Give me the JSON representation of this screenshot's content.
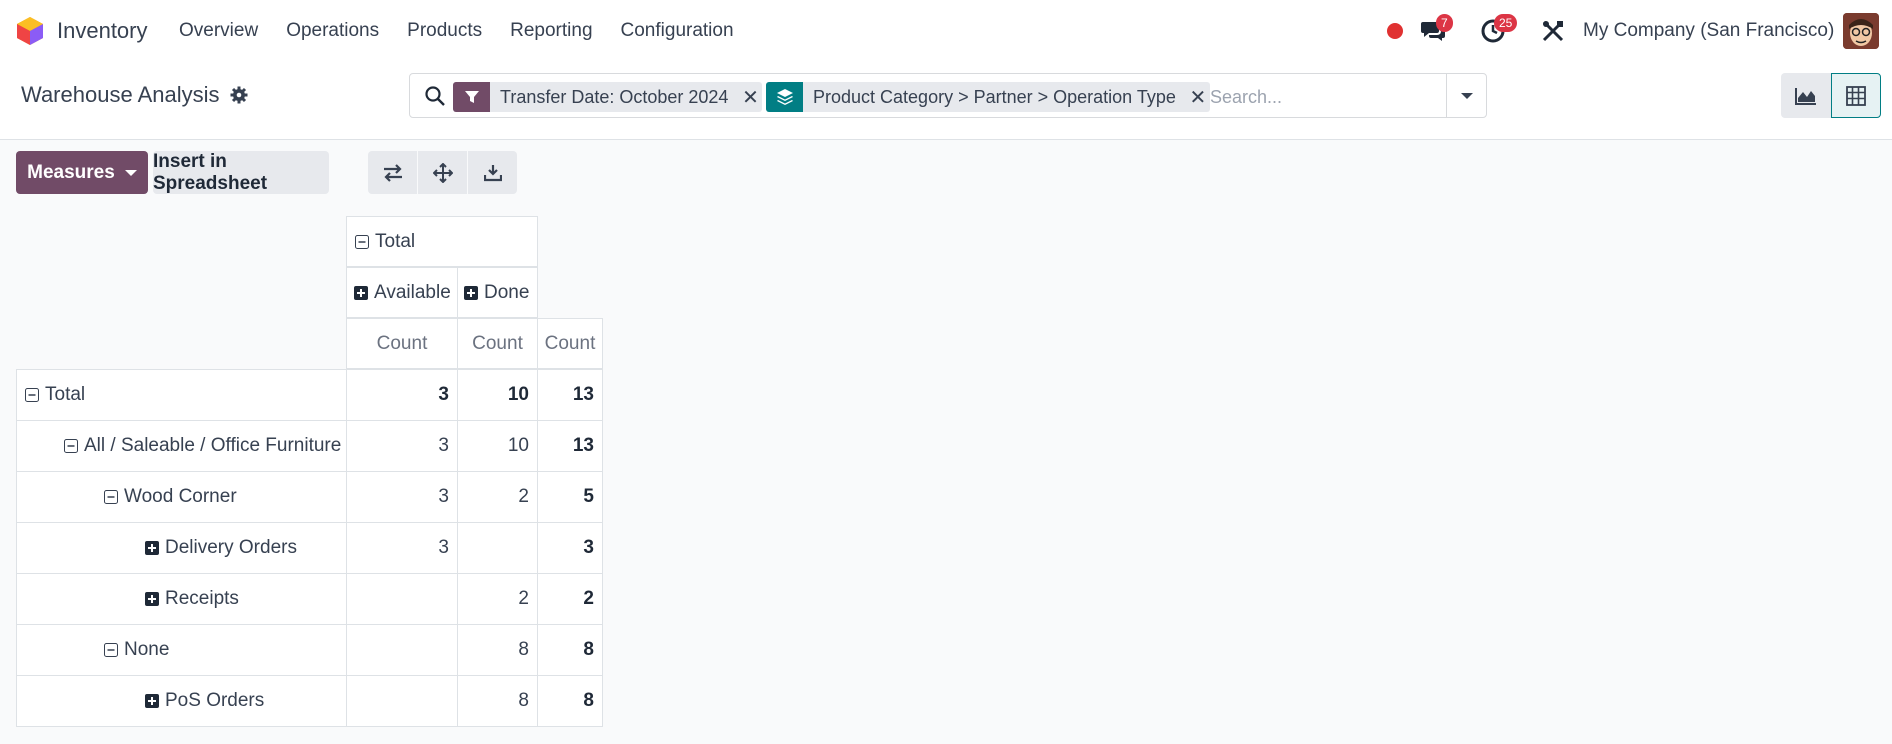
{
  "navbar": {
    "app_name": "Inventory",
    "menu": [
      "Overview",
      "Operations",
      "Products",
      "Reporting",
      "Configuration"
    ],
    "messages_count": "7",
    "activities_count": "25",
    "company": "My Company (San Francisco)",
    "colors": {
      "record": "#e03131",
      "badge": "#dc3545"
    }
  },
  "control_panel": {
    "title": "Warehouse Analysis",
    "facets": [
      {
        "icon": "filter-icon",
        "text": "Transfer Date: October 2024",
        "color": "#714b67"
      },
      {
        "icon": "groupby-layers-icon",
        "text": "Product Category > Partner > Operation Type",
        "color": "#017e84"
      }
    ],
    "search_placeholder": "Search...",
    "views": [
      "graph-view-icon",
      "pivot-view-icon"
    ],
    "active_view": "pivot"
  },
  "toolbar": {
    "measures_label": "Measures",
    "spreadsheet_label": "Insert in Spreadsheet",
    "icons": [
      "flip-axis-icon",
      "expand-all-icon",
      "download-icon"
    ],
    "accent": "#714b67"
  },
  "pivot": {
    "col_total": "Total",
    "col_groups": [
      "Available",
      "Done"
    ],
    "measure": "Count",
    "rows": [
      {
        "label": "Total",
        "level": 0,
        "expanded": true,
        "available": "3",
        "done": "10",
        "total": "13",
        "bold_all": true
      },
      {
        "label": "All / Saleable / Office Furniture",
        "level": 1,
        "expanded": true,
        "available": "3",
        "done": "10",
        "total": "13"
      },
      {
        "label": "Wood Corner",
        "level": 2,
        "expanded": true,
        "available": "3",
        "done": "2",
        "total": "5"
      },
      {
        "label": "Delivery Orders",
        "level": 3,
        "expanded": false,
        "available": "3",
        "done": "",
        "total": "3"
      },
      {
        "label": "Receipts",
        "level": 3,
        "expanded": false,
        "available": "",
        "done": "2",
        "total": "2"
      },
      {
        "label": "None",
        "level": 2,
        "expanded": true,
        "available": "",
        "done": "8",
        "total": "8"
      },
      {
        "label": "PoS Orders",
        "level": 3,
        "expanded": false,
        "available": "",
        "done": "8",
        "total": "8"
      }
    ]
  }
}
